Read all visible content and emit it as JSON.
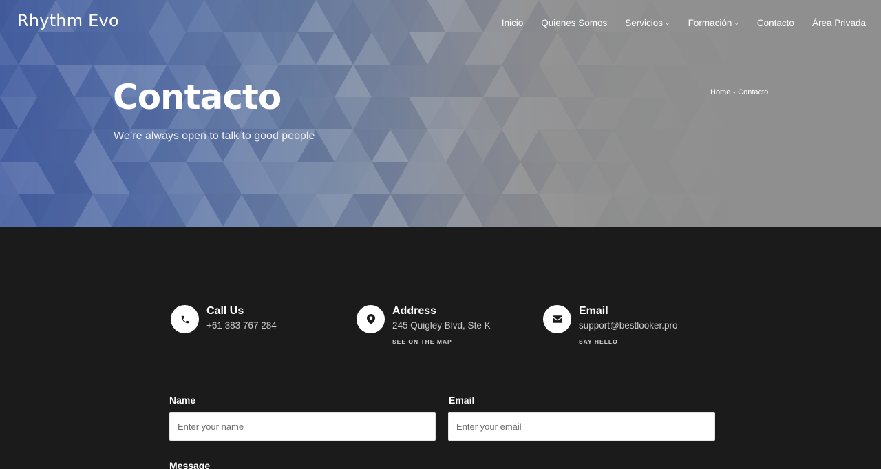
{
  "header": {
    "logo": "Rhythm Evo",
    "nav": [
      {
        "label": "Inicio",
        "has_dropdown": false
      },
      {
        "label": "Quienes Somos",
        "has_dropdown": false
      },
      {
        "label": "Servicios",
        "has_dropdown": true
      },
      {
        "label": "Formación",
        "has_dropdown": true
      },
      {
        "label": "Contacto",
        "has_dropdown": false
      },
      {
        "label": "Área Privada",
        "has_dropdown": false
      }
    ]
  },
  "hero": {
    "title": "Contacto",
    "subtitle": "We’re always open to talk to good people",
    "breadcrumb": {
      "home": "Home",
      "separator": "•",
      "current": "Contacto"
    }
  },
  "contact_info": {
    "call": {
      "icon": "phone-icon",
      "title": "Call Us",
      "value": "+61 383 767 284"
    },
    "address": {
      "icon": "map-pin-icon",
      "title": "Address",
      "value": "245 Quigley Blvd, Ste K",
      "link": "See on the map"
    },
    "email": {
      "icon": "envelope-icon",
      "title": "Email",
      "value": "support@bestlooker.pro",
      "link": "Say hello"
    }
  },
  "form": {
    "name_label": "Name",
    "name_placeholder": "Enter your name",
    "email_label": "Email",
    "email_placeholder": "Enter your email",
    "message_label": "Message"
  },
  "colors": {
    "hero_blue": "#4761a3",
    "hero_gray": "#8f8f8f",
    "page_background": "#1b1b1b",
    "icon_circle": "#ffffff"
  }
}
